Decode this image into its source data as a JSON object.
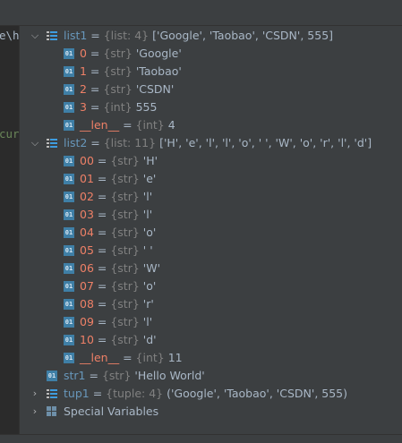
{
  "editor": {
    "frag1": "e\\h",
    "frag2": "cur"
  },
  "tree": {
    "list1": {
      "name": "list1",
      "type": "{list: 4}",
      "value": "['Google', 'Taobao', 'CSDN', 555]",
      "items": [
        {
          "index": "0",
          "type": "{str}",
          "value": "'Google'"
        },
        {
          "index": "1",
          "type": "{str}",
          "value": "'Taobao'"
        },
        {
          "index": "2",
          "type": "{str}",
          "value": "'CSDN'"
        },
        {
          "index": "3",
          "type": "{int}",
          "value": "555"
        },
        {
          "index": "__len__",
          "type": "{int}",
          "value": "4"
        }
      ]
    },
    "list2": {
      "name": "list2",
      "type": "{list: 11}",
      "value": "['H', 'e', 'l', 'l', 'o', ' ', 'W', 'o', 'r', 'l', 'd']",
      "items": [
        {
          "index": "00",
          "type": "{str}",
          "value": "'H'"
        },
        {
          "index": "01",
          "type": "{str}",
          "value": "'e'"
        },
        {
          "index": "02",
          "type": "{str}",
          "value": "'l'"
        },
        {
          "index": "03",
          "type": "{str}",
          "value": "'l'"
        },
        {
          "index": "04",
          "type": "{str}",
          "value": "'o'"
        },
        {
          "index": "05",
          "type": "{str}",
          "value": "' '"
        },
        {
          "index": "06",
          "type": "{str}",
          "value": "'W'"
        },
        {
          "index": "07",
          "type": "{str}",
          "value": "'o'"
        },
        {
          "index": "08",
          "type": "{str}",
          "value": "'r'"
        },
        {
          "index": "09",
          "type": "{str}",
          "value": "'l'"
        },
        {
          "index": "10",
          "type": "{str}",
          "value": "'d'"
        },
        {
          "index": "__len__",
          "type": "{int}",
          "value": "11"
        }
      ]
    },
    "str1": {
      "name": "str1",
      "type": "{str}",
      "value": "'Hello World'"
    },
    "tup1": {
      "name": "tup1",
      "type": "{tuple: 4}",
      "value": "('Google', 'Taobao', 'CSDN', 555)"
    },
    "special": {
      "label": "Special Variables"
    }
  },
  "colors": {
    "accent": "#3f9de0",
    "panel": "#3c3f41",
    "editor": "#2b2b2b"
  }
}
